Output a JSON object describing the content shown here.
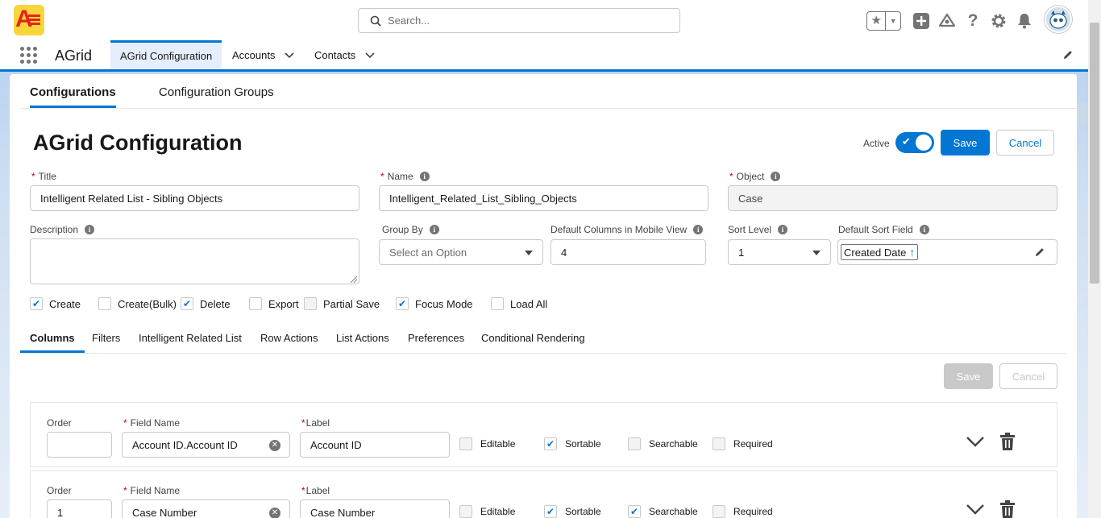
{
  "header": {
    "search_placeholder": "Search..."
  },
  "nav": {
    "app_name": "AGrid",
    "items": [
      {
        "label": "AGrid Configuration"
      },
      {
        "label": "Accounts"
      },
      {
        "label": "Contacts"
      }
    ]
  },
  "top_tabs": [
    {
      "label": "Configurations"
    },
    {
      "label": "Configuration Groups"
    }
  ],
  "page": {
    "title": "AGrid Configuration",
    "active_label": "Active",
    "active_on": true,
    "save_label": "Save",
    "cancel_label": "Cancel"
  },
  "form": {
    "title_label": "Title",
    "title_value": "Intelligent Related List - Sibling Objects",
    "name_label": "Name",
    "name_value": "Intelligent_Related_List_Sibling_Objects",
    "object_label": "Object",
    "object_value": "Case",
    "description_label": "Description",
    "description_value": "",
    "group_by_label": "Group By",
    "group_by_placeholder": "Select an Option",
    "mobile_cols_label": "Default Columns in Mobile View",
    "mobile_cols_value": "4",
    "sort_level_label": "Sort Level",
    "sort_level_value": "1",
    "sort_field_label": "Default Sort Field",
    "sort_field_value": "Created Date"
  },
  "options": [
    {
      "label": "Create",
      "checked": true
    },
    {
      "label": "Create(Bulk)",
      "checked": false
    },
    {
      "label": "Delete",
      "checked": true
    },
    {
      "label": "Export",
      "checked": false
    },
    {
      "label": "Partial Save",
      "checked": false,
      "disabled": true
    },
    {
      "label": "Focus Mode",
      "checked": true
    },
    {
      "label": "Load All",
      "checked": false
    }
  ],
  "sub_tabs": [
    {
      "label": "Columns"
    },
    {
      "label": "Filters"
    },
    {
      "label": "Intelligent Related List"
    },
    {
      "label": "Row Actions"
    },
    {
      "label": "List Actions"
    },
    {
      "label": "Preferences"
    },
    {
      "label": "Conditional Rendering"
    }
  ],
  "columns_toolbar": {
    "save_label": "Save",
    "cancel_label": "Cancel"
  },
  "column_labels": {
    "order": "Order",
    "field_name": "Field Name",
    "label": "Label",
    "editable": "Editable",
    "sortable": "Sortable",
    "searchable": "Searchable",
    "required": "Required"
  },
  "columns": [
    {
      "order": "",
      "field_name": "Account ID.Account ID",
      "label": "Account ID",
      "editable": false,
      "sortable": true,
      "searchable": false,
      "required": false
    },
    {
      "order": "1",
      "field_name": "Case Number",
      "label": "Case Number",
      "editable": false,
      "sortable": true,
      "searchable": true,
      "required": false
    }
  ]
}
